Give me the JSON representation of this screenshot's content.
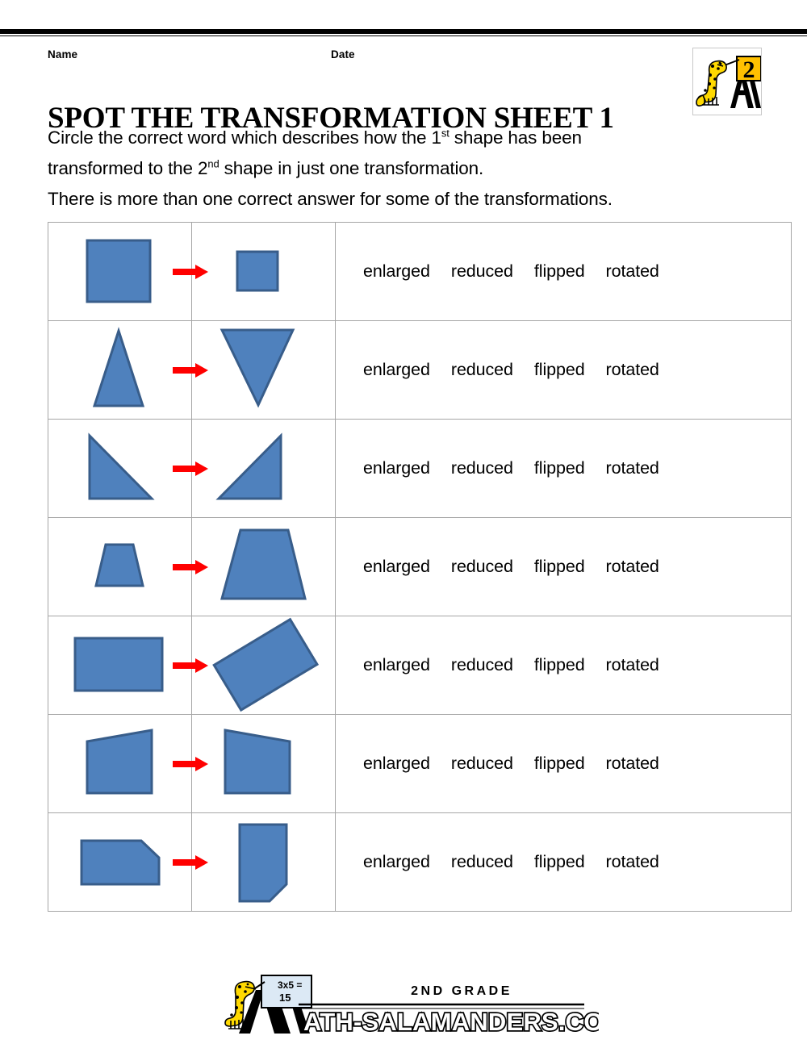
{
  "page": {
    "name_label": "Name",
    "date_label": "Date",
    "title": "SPOT THE TRANSFORMATION SHEET 1",
    "instructions": [
      "Circle the correct word which describes how the 1st shape has been",
      "transformed to the 2nd shape in just one transformation.",
      "There is more than one correct answer for some of the transformations."
    ],
    "instruction_line1_pre": "Circle the correct word which describes how the 1",
    "instruction_line1_sup": "st",
    "instruction_line1_post": " shape has been",
    "instruction_line2_pre": "transformed to the 2",
    "instruction_line2_sup": "nd",
    "instruction_line2_post": " shape in just one transformation.",
    "instruction_line3": "There is more than one correct answer for some of the transformations."
  },
  "header_logo": {
    "name": "math-salamanders-grade-badge",
    "grade_number": "2",
    "salamander_color": "#FFD900",
    "badge_color": "#FFC000"
  },
  "colors": {
    "shape_fill": "#4F81BD",
    "shape_stroke": "#385D8A",
    "arrow": "#FF0000",
    "table_border": "#A6A6A6",
    "rule": "#000000"
  },
  "answer_options": [
    "enlarged",
    "reduced",
    "flipped",
    "rotated"
  ],
  "rows": [
    {
      "index": 1,
      "shape_before": "large-square",
      "shape_after": "small-square",
      "transformation_hint": "reduced",
      "options": [
        "enlarged",
        "reduced",
        "flipped",
        "rotated"
      ]
    },
    {
      "index": 2,
      "shape_before": "triangle-up",
      "shape_after": "triangle-down",
      "transformation_hint": "flipped",
      "options": [
        "enlarged",
        "reduced",
        "flipped",
        "rotated"
      ]
    },
    {
      "index": 3,
      "shape_before": "right-triangle-left",
      "shape_after": "right-triangle-right",
      "transformation_hint": "flipped",
      "options": [
        "enlarged",
        "reduced",
        "flipped",
        "rotated"
      ]
    },
    {
      "index": 4,
      "shape_before": "small-trapezoid",
      "shape_after": "large-trapezoid",
      "transformation_hint": "enlarged",
      "options": [
        "enlarged",
        "reduced",
        "flipped",
        "rotated"
      ]
    },
    {
      "index": 5,
      "shape_before": "rectangle",
      "shape_after": "rotated-rectangle",
      "transformation_hint": "rotated",
      "options": [
        "enlarged",
        "reduced",
        "flipped",
        "rotated"
      ]
    },
    {
      "index": 6,
      "shape_before": "quadrilateral-right-high",
      "shape_after": "quadrilateral-left-high",
      "transformation_hint": "flipped",
      "options": [
        "enlarged",
        "reduced",
        "flipped",
        "rotated"
      ]
    },
    {
      "index": 7,
      "shape_before": "pentagon-horizontal",
      "shape_after": "pentagon-vertical",
      "transformation_hint": "rotated",
      "options": [
        "enlarged",
        "reduced",
        "flipped",
        "rotated"
      ]
    }
  ],
  "footer": {
    "grade_text": "2ND GRADE",
    "site_text": "MATH-SALAMANDERS.COM",
    "whiteboard_line1": "3x5 =",
    "whiteboard_line2": "15"
  }
}
